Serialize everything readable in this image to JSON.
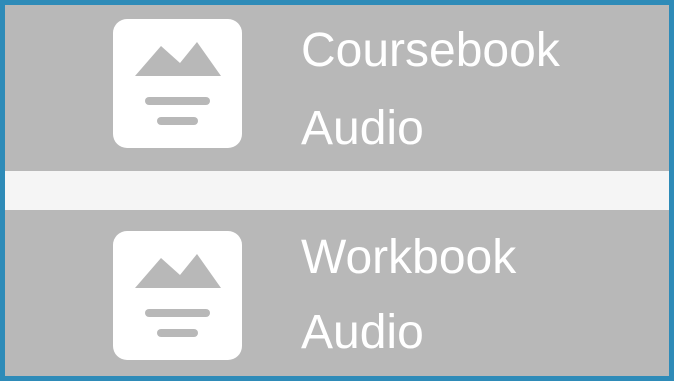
{
  "items": [
    {
      "line1": "Coursebook",
      "line2": "Audio",
      "icon": "document-image-icon"
    },
    {
      "line1": "Workbook",
      "line2": "Audio",
      "icon": "document-image-icon"
    }
  ],
  "colors": {
    "frame_border": "#2e8bb8",
    "item_background": "#b8b8b8",
    "divider": "#f5f5f5",
    "icon_tile": "#ffffff",
    "icon_glyph": "#b8b8b8",
    "text": "#ffffff"
  }
}
